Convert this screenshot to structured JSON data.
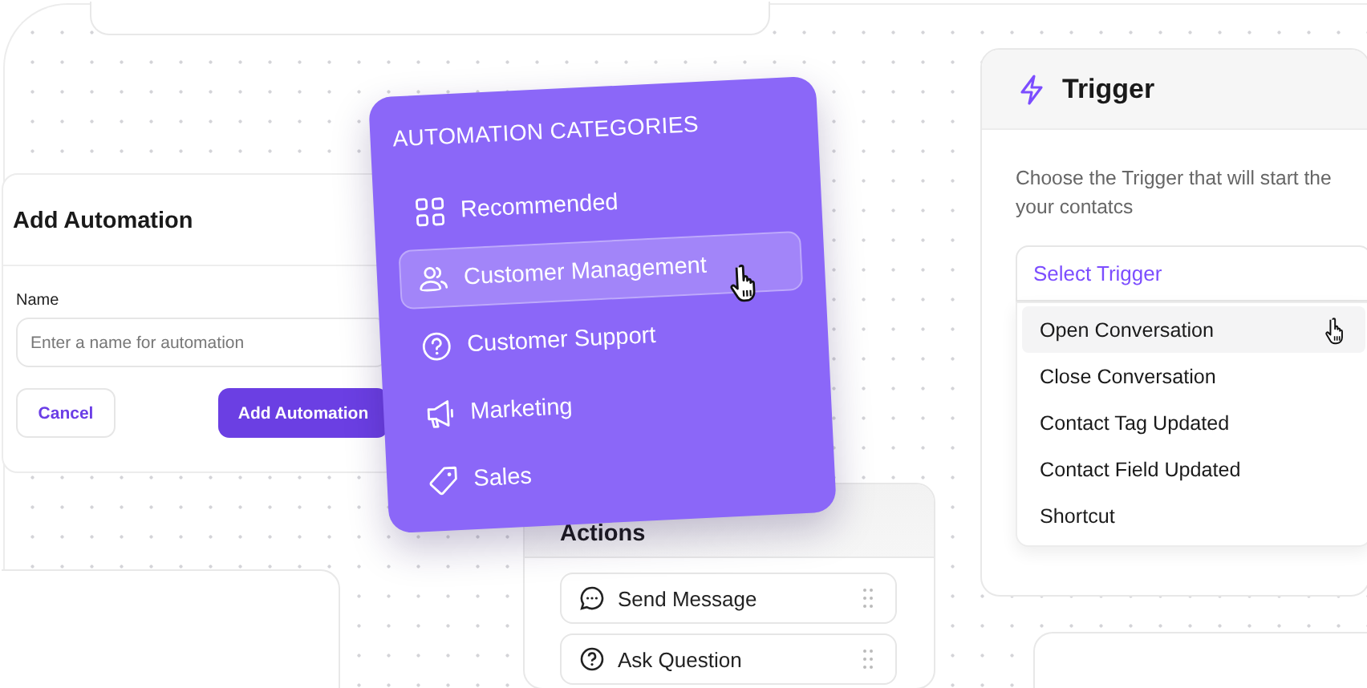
{
  "add_automation": {
    "title": "Add Automation",
    "name_label": "Name",
    "name_placeholder": "Enter a name for automation",
    "buttons": [
      {
        "label": "Cancel",
        "kind": "secondary"
      },
      {
        "label": "Add Automation",
        "kind": "primary"
      }
    ]
  },
  "categories": {
    "title": "AUTOMATION CATEGORIES",
    "items": [
      {
        "label": "Recommended",
        "selected": false
      },
      {
        "label": "Customer Management",
        "selected": true
      },
      {
        "label": "Customer Support",
        "selected": false
      },
      {
        "label": "Marketing",
        "selected": false
      },
      {
        "label": "Sales",
        "selected": false
      }
    ]
  },
  "actions": {
    "title": "Actions",
    "items": [
      {
        "label": "Send Message"
      },
      {
        "label": "Ask Question"
      }
    ]
  },
  "trigger": {
    "title": "Trigger",
    "description_lines": [
      "Choose the Trigger that will start the",
      "your contatcs"
    ],
    "select": {
      "placeholder": "Select Trigger"
    },
    "options": [
      {
        "label": "Open Conversation",
        "selected": true
      },
      {
        "label": "Close Conversation",
        "selected": false
      },
      {
        "label": "Contact Tag Updated",
        "selected": false
      },
      {
        "label": "Contact Field Updated",
        "selected": false
      },
      {
        "label": "Shortcut",
        "selected": false
      }
    ]
  }
}
